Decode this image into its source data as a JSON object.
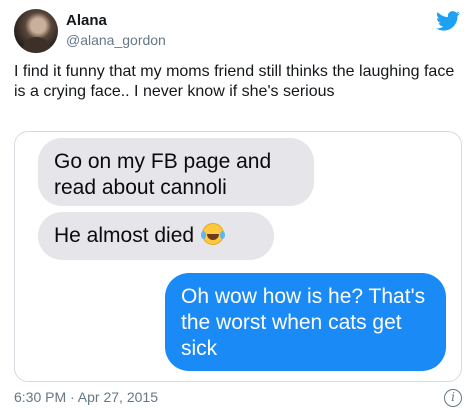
{
  "author": {
    "name": "Alana",
    "handle": "@alana_gordon"
  },
  "tweet": {
    "text": "I find it funny that my moms friend still thinks the laughing face is a crying face.. I never know if she's serious"
  },
  "messages": [
    {
      "side": "received",
      "text": "Go on my FB page and read about cannoli"
    },
    {
      "side": "received",
      "text": "He almost died",
      "emoji": "face-with-tears-of-joy"
    },
    {
      "side": "sent",
      "text": "Oh wow how is he? That's the worst when cats get sick"
    }
  ],
  "timestamp": "6:30 PM · Apr 27, 2015",
  "icons": {
    "logo": "twitter-bird-icon",
    "info": "info-icon",
    "info_glyph": "i"
  },
  "colors": {
    "brand": "#1da1f2",
    "sent_bubble": "#1a8af6",
    "received_bubble": "#e5e5ea",
    "secondary_text": "#657786"
  }
}
